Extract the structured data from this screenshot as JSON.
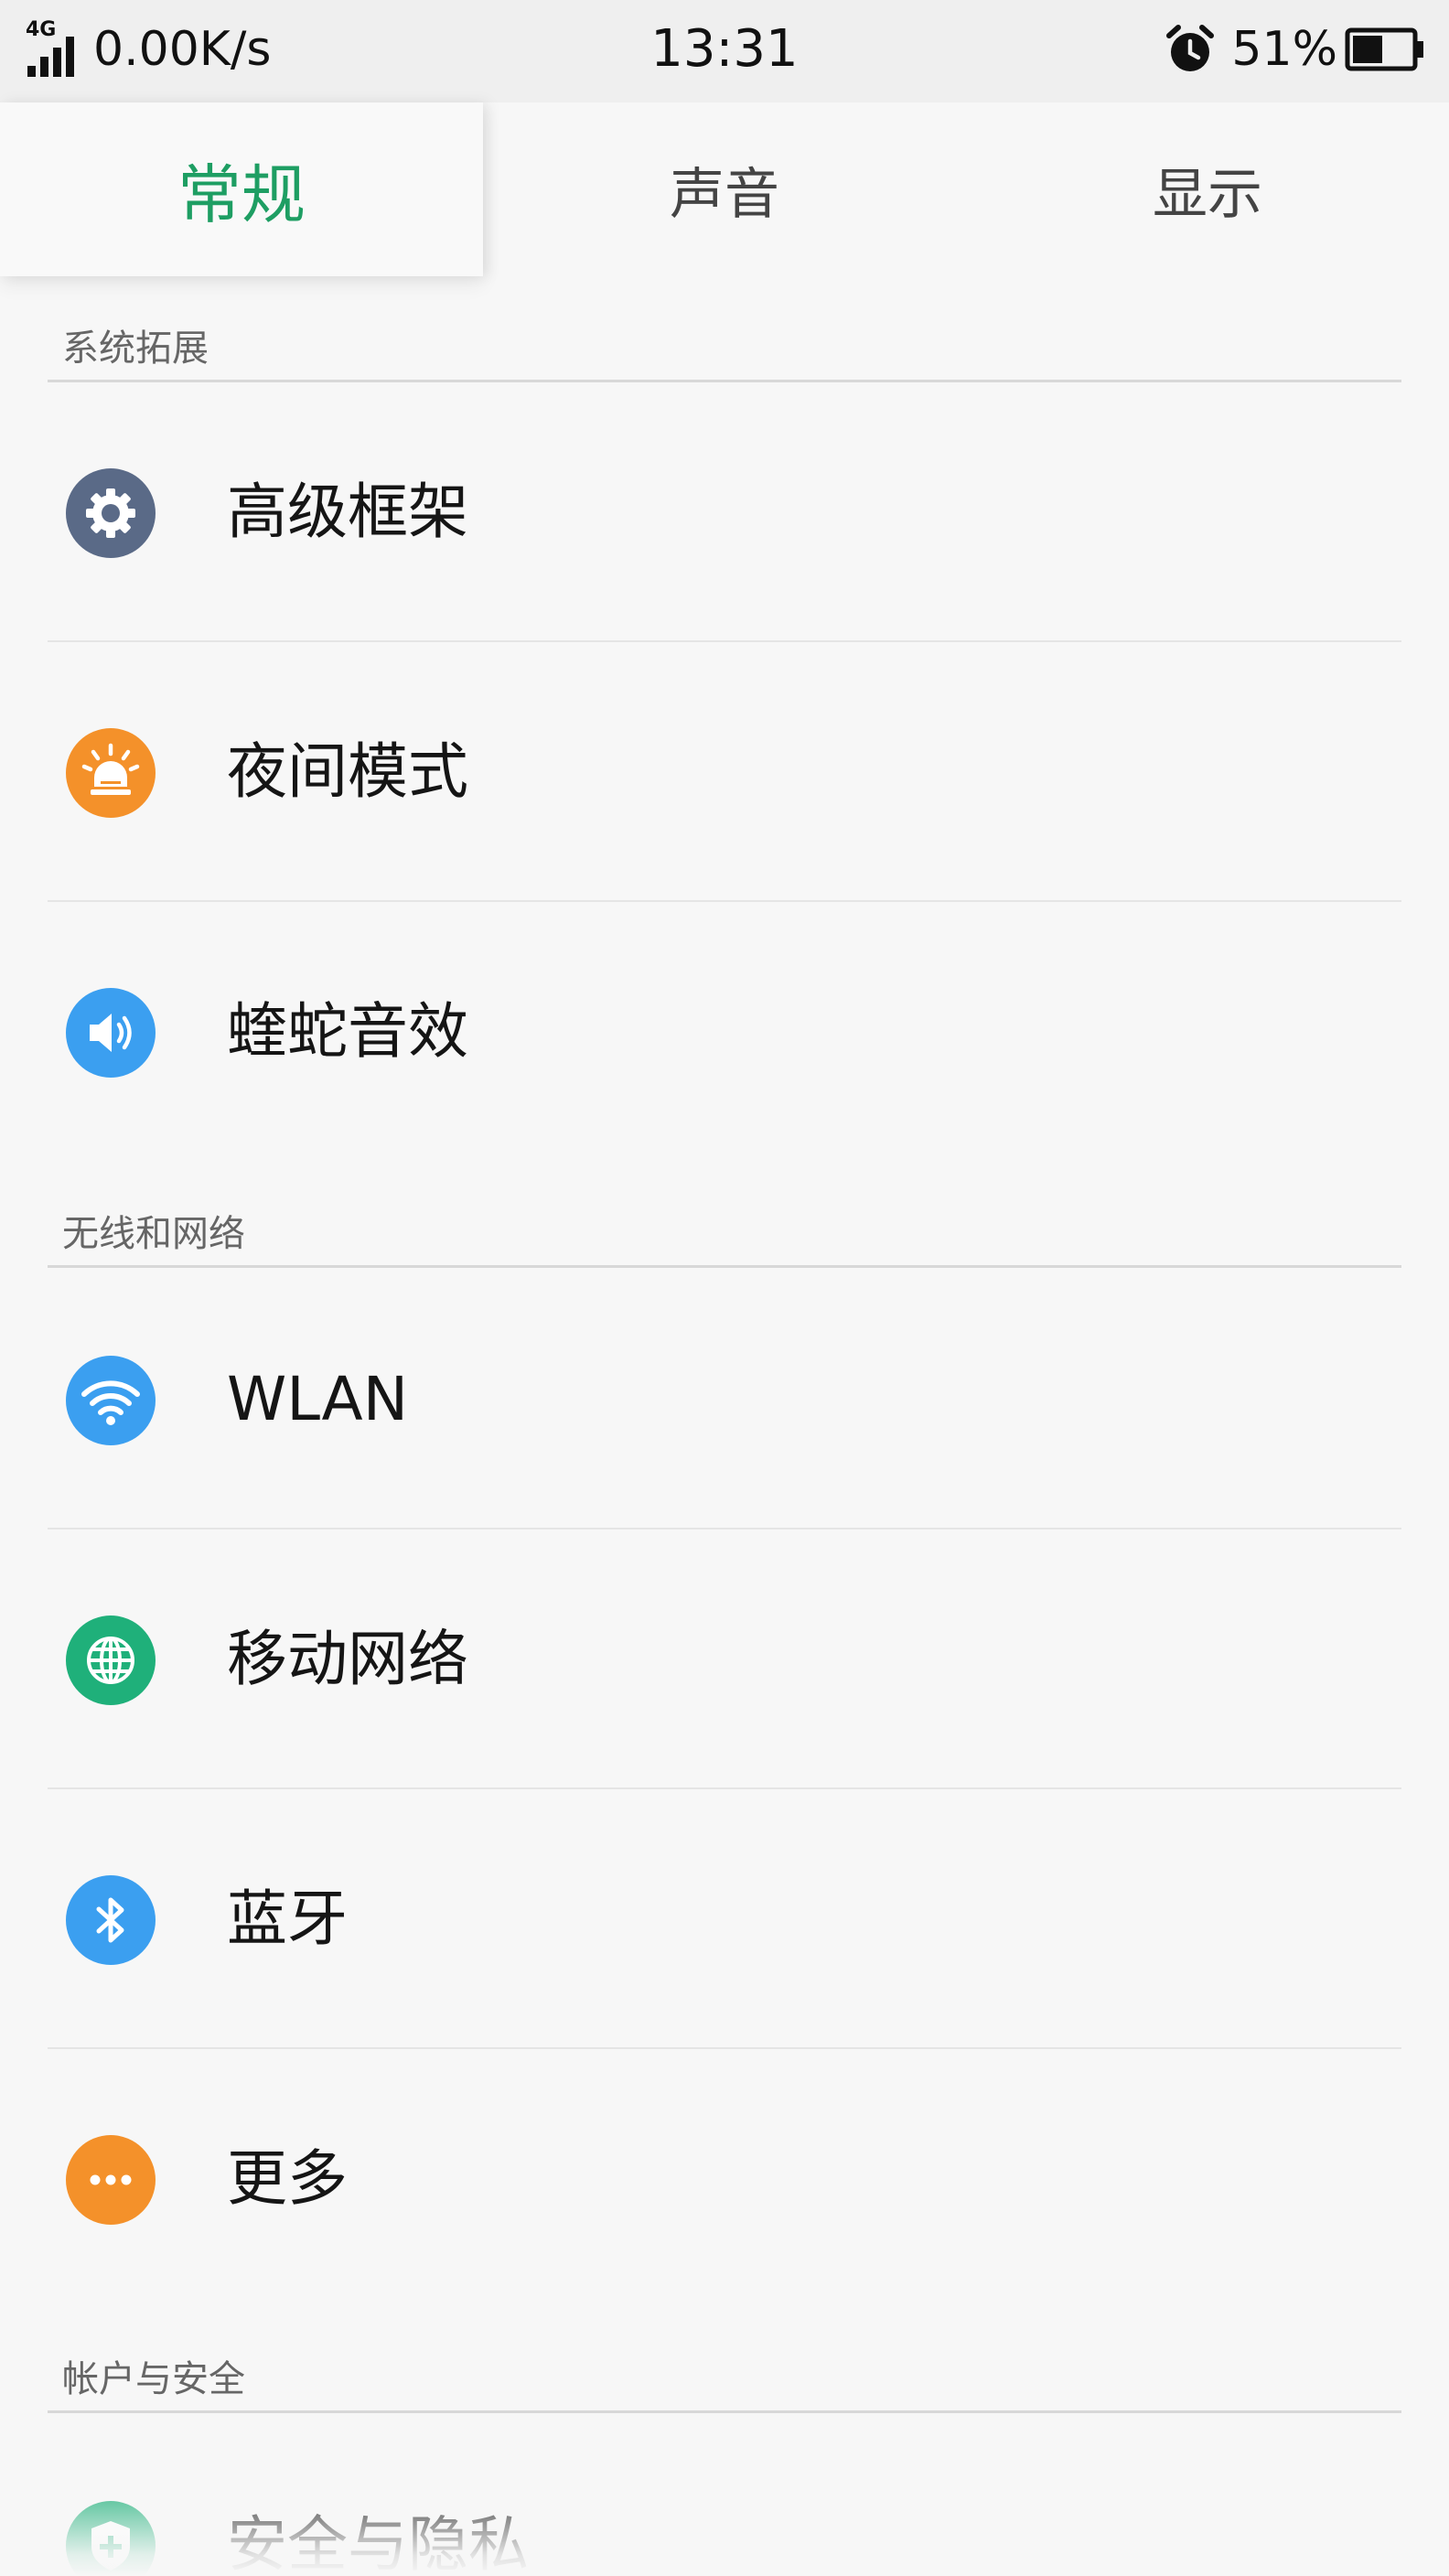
{
  "status_bar": {
    "network_type": "4G",
    "speed": "0.00K/s",
    "time": "13:31",
    "battery_percent": "51%",
    "battery_level": 0.51
  },
  "tabs": [
    {
      "label": "常规",
      "active": true
    },
    {
      "label": "声音",
      "active": false
    },
    {
      "label": "显示",
      "active": false
    }
  ],
  "sections": [
    {
      "title": "系统拓展",
      "items": [
        {
          "label": "高级框架",
          "icon": "gear-icon",
          "color": "#5a6a87"
        },
        {
          "label": "夜间模式",
          "icon": "night-light-icon",
          "color": "#f4912a"
        },
        {
          "label": "蝰蛇音效",
          "icon": "speaker-icon",
          "color": "#3b9ff0"
        }
      ]
    },
    {
      "title": "无线和网络",
      "items": [
        {
          "label": "WLAN",
          "icon": "wifi-icon",
          "color": "#3b9ff0"
        },
        {
          "label": "移动网络",
          "icon": "globe-icon",
          "color": "#1fb07a"
        },
        {
          "label": "蓝牙",
          "icon": "bluetooth-icon",
          "color": "#3b9ff0"
        },
        {
          "label": "更多",
          "icon": "more-dots-icon",
          "color": "#f4912a"
        }
      ]
    },
    {
      "title": "帐户与安全",
      "items": [
        {
          "label": "安全与隐私",
          "icon": "shield-icon",
          "color": "#1fb07a"
        }
      ]
    }
  ]
}
